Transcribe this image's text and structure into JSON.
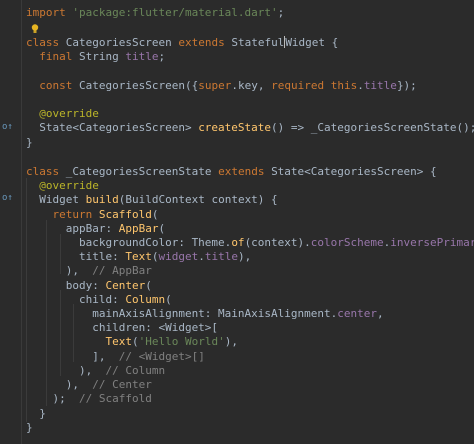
{
  "code_lines": [
    "import 'package:flutter/material.dart';",
    "",
    "class CategoriesScreen extends StatefulWidget {",
    "  final String title;",
    "",
    "  const CategoriesScreen({super.key, required this.title});",
    "",
    "  @override",
    "  State<CategoriesScreen> createState() => _CategoriesScreenState();",
    "}",
    "",
    "class _CategoriesScreenState extends State<CategoriesScreen> {",
    "  @override",
    "  Widget build(BuildContext context) {",
    "    return Scaffold(",
    "      appBar: AppBar(",
    "        backgroundColor: Theme.of(context).colorScheme.inversePrimary,",
    "        title: Text(widget.title),",
    "      ),  // AppBar",
    "      body: Center(",
    "        child: Column(",
    "          mainAxisAlignment: MainAxisAlignment.center,",
    "          children: <Widget>[",
    "            Text('Hello World'),",
    "          ],  // <Widget>[]",
    "        ),  // Column",
    "      ),  // Center",
    "    );  // Scaffold",
    "  }",
    "}"
  ],
  "colors": {
    "background": "#2b2b2b",
    "keyword": "#cc7832",
    "string": "#6a8759",
    "function": "#ffc66d",
    "field": "#9876aa",
    "annotation": "#bbb529",
    "comment": "#808080",
    "text": "#a9b7c6"
  }
}
